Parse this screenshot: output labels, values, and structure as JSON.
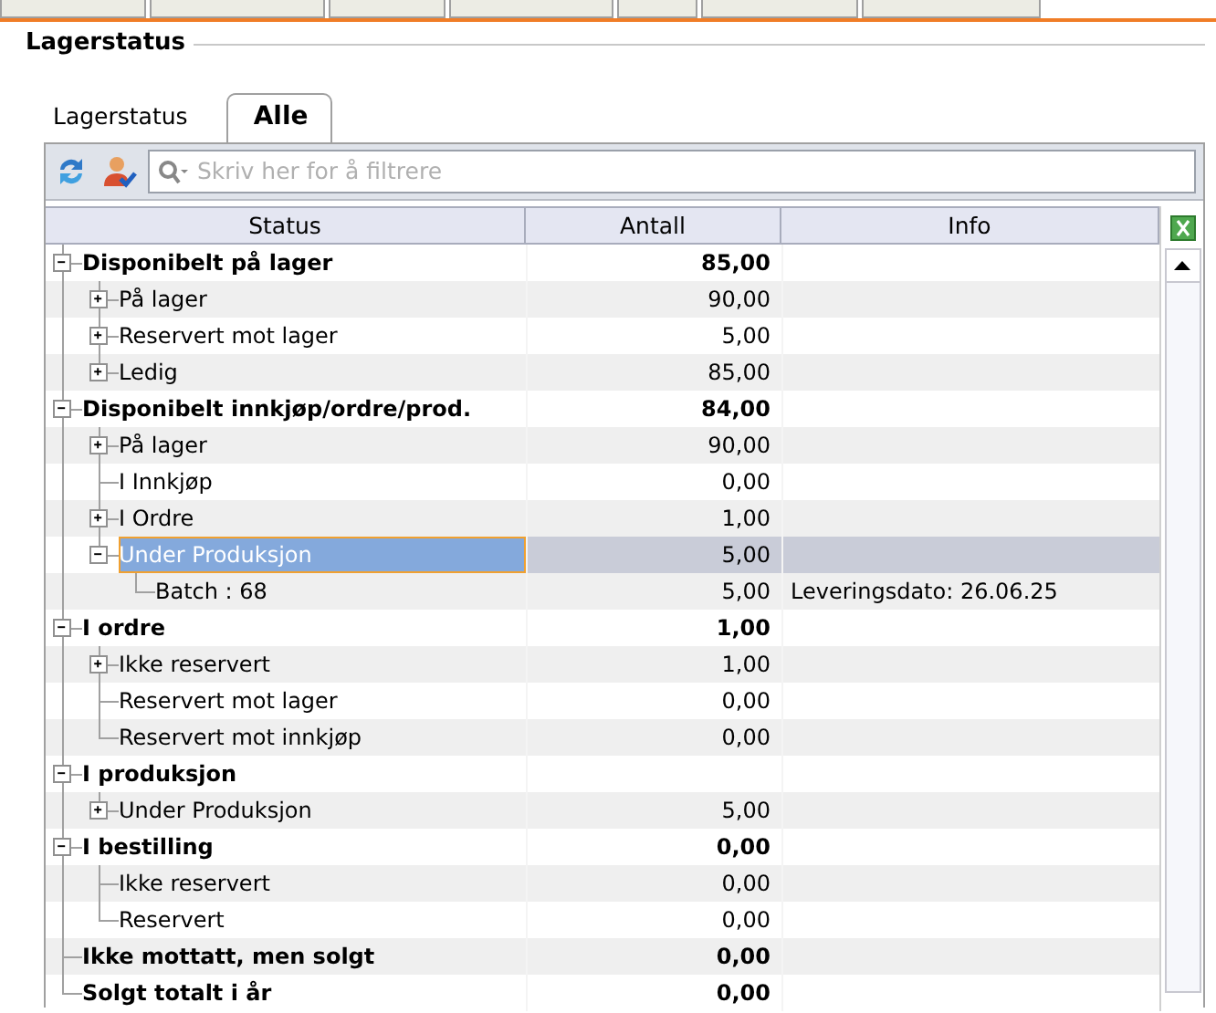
{
  "group_title": "Lagerstatus",
  "tabs": [
    {
      "label": "Lagerstatus",
      "selected": false
    },
    {
      "label": "Alle",
      "selected": true
    }
  ],
  "search": {
    "placeholder": "Skriv her for å filtrere"
  },
  "table": {
    "columns": [
      "Status",
      "Antall",
      "Info"
    ],
    "rows": [
      {
        "status": "Disponibelt på lager",
        "antall": "85,00",
        "bold": true,
        "expanded": true,
        "selected": false,
        "children": [
          {
            "status": "På lager",
            "antall": "90,00",
            "expanded": false,
            "selected": false
          },
          {
            "status": "Reservert mot lager",
            "antall": "5,00",
            "expanded": false,
            "selected": false
          },
          {
            "status": "Ledig",
            "antall": "85,00",
            "expanded": false,
            "selected": false
          }
        ]
      },
      {
        "status": "Disponibelt innkjøp/ordre/prod.",
        "antall": "84,00",
        "bold": true,
        "expanded": true,
        "selected": false,
        "children": [
          {
            "status": "På lager",
            "antall": "90,00",
            "expanded": false,
            "selected": false
          },
          {
            "status": "I Innkjøp",
            "antall": "0,00",
            "selected": false
          },
          {
            "status": "I Ordre",
            "antall": "1,00",
            "expanded": false,
            "selected": false
          },
          {
            "status": "Under Produksjon",
            "antall": "5,00",
            "expanded": true,
            "selected": true,
            "children": [
              {
                "status": "Batch : 68",
                "antall": "5,00",
                "info": "Leveringsdato: 26.06.25",
                "selected": false
              }
            ]
          }
        ]
      },
      {
        "status": "I ordre",
        "antall": "1,00",
        "bold": true,
        "expanded": true,
        "selected": false,
        "children": [
          {
            "status": "Ikke reservert",
            "antall": "1,00",
            "expanded": false,
            "selected": false
          },
          {
            "status": "Reservert mot lager",
            "antall": "0,00",
            "selected": false
          },
          {
            "status": "Reservert mot innkjøp",
            "antall": "0,00",
            "selected": false
          }
        ]
      },
      {
        "status": "I produksjon",
        "bold": true,
        "expanded": true,
        "selected": false,
        "children": [
          {
            "status": "Under Produksjon",
            "antall": "5,00",
            "expanded": false,
            "selected": false
          }
        ]
      },
      {
        "status": "I bestilling",
        "antall": "0,00",
        "bold": true,
        "expanded": true,
        "selected": false,
        "children": [
          {
            "status": "Ikke reservert",
            "antall": "0,00",
            "selected": false
          },
          {
            "status": "Reservert",
            "antall": "0,00",
            "selected": false
          }
        ]
      },
      {
        "status": "Ikke mottatt, men solgt",
        "antall": "0,00",
        "bold": true,
        "selected": false
      },
      {
        "status": "Solgt totalt i år",
        "antall": "0,00",
        "bold": true,
        "selected": false
      }
    ]
  }
}
